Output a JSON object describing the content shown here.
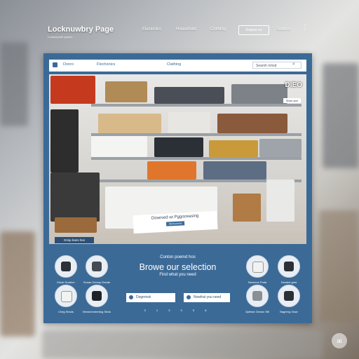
{
  "header": {
    "site_title": "Locknuwbry Page",
    "site_subtitle": "Lorasmpanb grasne",
    "nav": [
      "Elecionics",
      "Household",
      "Clothing"
    ],
    "search_box": "Dnpsa ns",
    "search_link": "Soanss"
  },
  "inner_nav": {
    "items": [
      "Donro",
      "Flechonics",
      "Clathing"
    ],
    "search_placeholder": "Searsh nmsd"
  },
  "hero": {
    "logo": "DIEO",
    "badge": "Shon aon",
    "caption_line": "Dowrsed wi Pggoceasing",
    "caption_button": "Sbonaunmo",
    "tag": "Grisp bans hes"
  },
  "promo": {
    "eyebrow": "Conton poemd hos",
    "title": "Browe our selection",
    "subtitle": "Find what you need",
    "button_left": "Dogemsk",
    "button_right": "Nowfrat you need"
  },
  "categories_left": [
    {
      "label": "Klodo Sudenn",
      "icon": "smartphone-icon",
      "color": "#2b2f36"
    },
    {
      "label": "Snoas Gerosp Dsnde",
      "icon": "camera-icon",
      "color": "#444b55"
    },
    {
      "label": "Cheg Sbsds",
      "icon": "headphones-icon",
      "color": "#f2f2f2"
    },
    {
      "label": "Breckernsterdsg Sbda",
      "icon": "tablet-icon",
      "color": "#1f2329"
    }
  ],
  "categories_right": [
    {
      "label": "Nionrecs Pnda",
      "icon": "sneaker-icon",
      "color": "#f2f2f2"
    },
    {
      "label": "Dsrsbel geet",
      "icon": "gamepad-icon",
      "color": "#2b2f36"
    },
    {
      "label": "Gpfbice Gnwsn Stll",
      "icon": "console-icon",
      "color": "#8a8f96"
    },
    {
      "label": "Bagreng Gsse",
      "icon": "calculator-icon",
      "color": "#2b2f36"
    }
  ],
  "pagination": "3 1 3 3 5 6",
  "watermark": "ai",
  "colors": {
    "panel": "#3c6a97",
    "accent": "#2c4f73"
  }
}
